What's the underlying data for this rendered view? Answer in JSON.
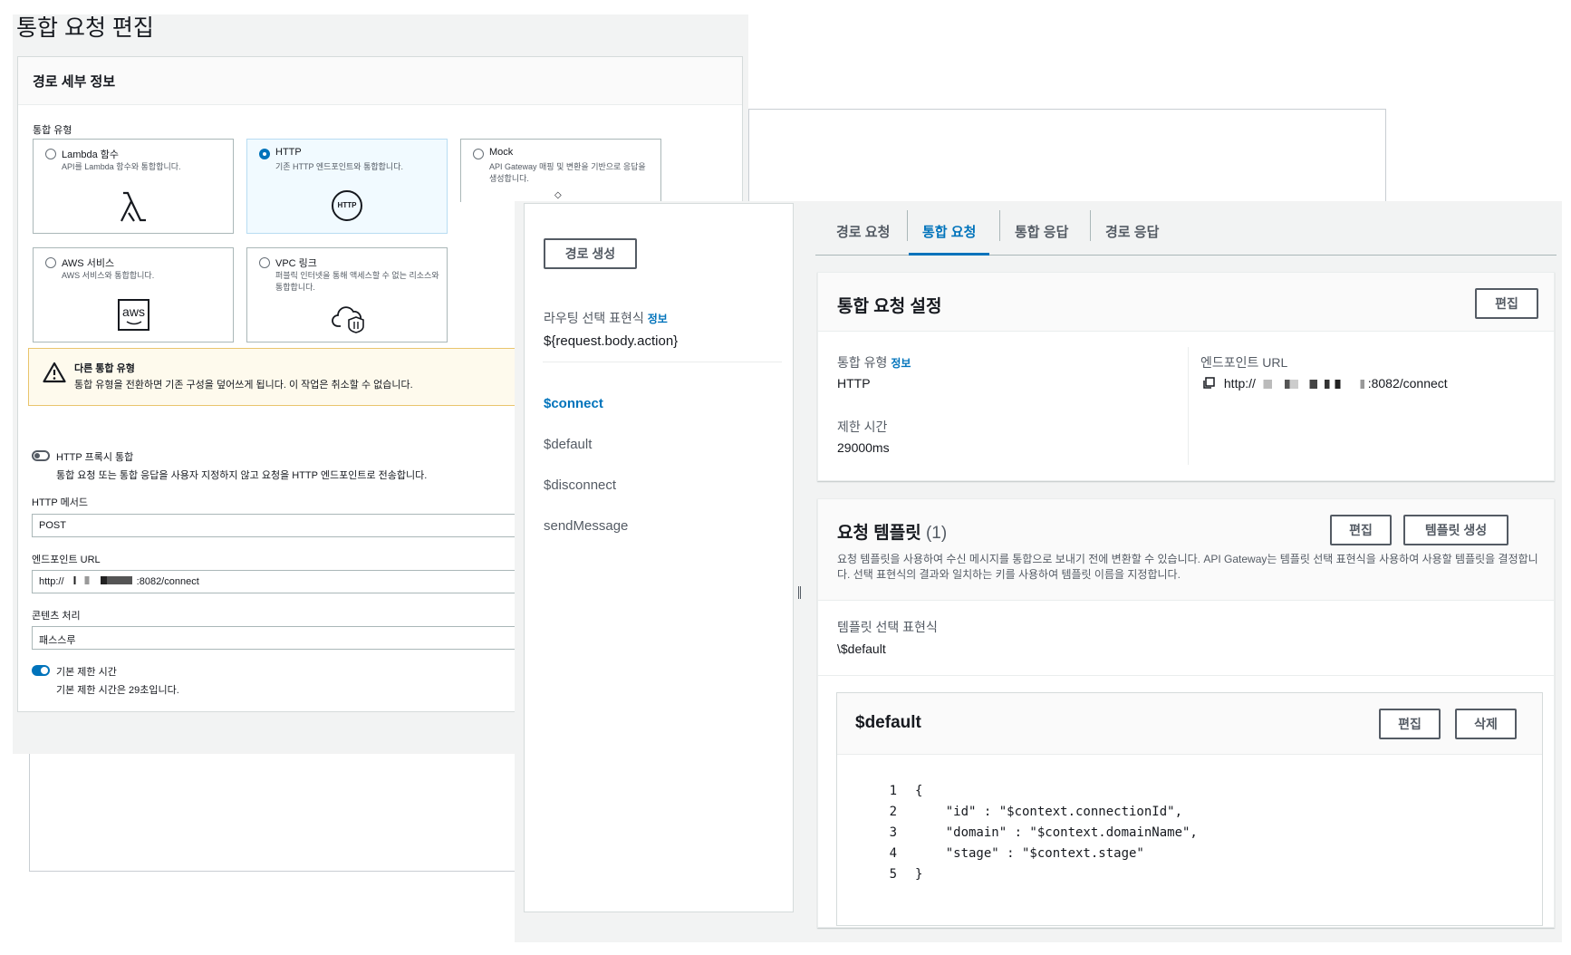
{
  "edit_page": {
    "title": "통합 요청 편집",
    "route_details": {
      "heading": "경로 세부 정보",
      "integration_type_label": "통합 유형",
      "options": [
        {
          "title": "Lambda 함수",
          "desc": "API를 Lambda 함수와 통합합니다.",
          "icon": "lambda-icon",
          "selected": false
        },
        {
          "title": "HTTP",
          "desc": "기존 HTTP 엔드포인트와 통합합니다.",
          "icon": "http-icon",
          "icon_text": "HTTP",
          "selected": true
        },
        {
          "title": "Mock",
          "desc": "API Gateway 매핑 및 변환을 기반으로 응답을 생성합니다.",
          "icon": "mock-icon",
          "selected": false
        },
        {
          "title": "AWS 서비스",
          "desc": "AWS 서비스와 통합합니다.",
          "icon": "aws-icon",
          "icon_text": "aws",
          "selected": false
        },
        {
          "title": "VPC 링크",
          "desc": "퍼블릭 인터넷을 통해 액세스할 수 없는 리소스와 통합합니다.",
          "icon": "vpc-cloud-icon",
          "selected": false
        }
      ],
      "warning": {
        "title": "다른 통합 유형",
        "text": "통합 유형을 전환하면 기존 구성을 덮어쓰게 됩니다. 이 작업은 취소할 수 없습니다."
      },
      "http_proxy": {
        "label": "HTTP 프록시 통합",
        "desc": "통합 요청 또는 통합 응답을 사용자 지정하지 않고 요청을 HTTP 엔드포인트로 전송합니다.",
        "enabled": false
      },
      "http_method": {
        "label": "HTTP 메서드",
        "value": "POST"
      },
      "endpoint_url": {
        "label": "엔드포인트 URL",
        "value_prefix": "http://",
        "value_suffix": ":8082/connect"
      },
      "content_handling": {
        "label": "콘텐츠 처리",
        "value": "패스스루"
      },
      "default_timeout": {
        "label": "기본 제한 시간",
        "desc": "기본 제한 시간은 29초입니다.",
        "enabled": true
      }
    }
  },
  "console": {
    "routes_panel": {
      "create_route": "경로 생성",
      "route_selection_expression_label": "라우팅 선택 표현식",
      "info": "정보",
      "route_selection_expression_value": "${request.body.action}",
      "routes": [
        "$connect",
        "$default",
        "$disconnect",
        "sendMessage"
      ],
      "active_route": "$connect"
    },
    "tabs": [
      "경로 요청",
      "통합 요청",
      "통합 응답",
      "경로 응답"
    ],
    "active_tab": "통합 요청",
    "integration_settings": {
      "title": "통합 요청 설정",
      "edit": "편집",
      "integration_type_label": "통합 유형",
      "info": "정보",
      "integration_type_value": "HTTP",
      "timeout_label": "제한 시간",
      "timeout_value": "29000ms",
      "endpoint_label": "엔드포인트 URL",
      "endpoint_prefix": "http://",
      "endpoint_suffix": ":8082/connect"
    },
    "request_templates": {
      "title": "요청 템플릿",
      "count": "(1)",
      "edit": "편집",
      "create": "템플릿 생성",
      "description": "요청 템플릿을 사용하여 수신 메시지를 통합으로 보내기 전에 변환할 수 있습니다. API Gateway는 템플릿 선택 표현식을 사용하여 사용할 템플릿을 결정합니다. 선택 표현식의 결과와 일치하는 키를 사용하여 템플릿 이름을 지정합니다.",
      "selection_expression_label": "템플릿 선택 표현식",
      "selection_expression_value": "\\$default",
      "template": {
        "name": "$default",
        "edit": "편집",
        "delete": "삭제",
        "lines": [
          {
            "n": "1",
            "text": "{"
          },
          {
            "n": "2",
            "text": "    \"id\" : \"$context.connectionId\","
          },
          {
            "n": "3",
            "text": "    \"domain\" : \"$context.domainName\","
          },
          {
            "n": "4",
            "text": "    \"stage\" : \"$context.stage\""
          },
          {
            "n": "5",
            "text": "}"
          }
        ]
      }
    }
  },
  "colors": {
    "accent": "#0073bb",
    "warning_bg": "#fefaed",
    "warning_border": "#e9c56d",
    "selected_card_bg": "#f1faff"
  }
}
